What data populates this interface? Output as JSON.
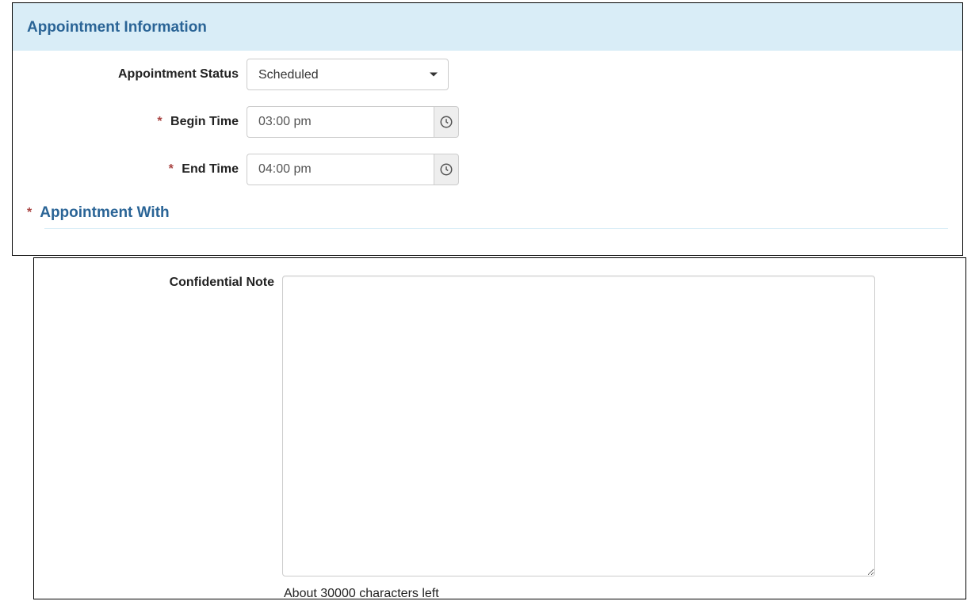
{
  "section1": {
    "title": "Appointment Information",
    "rows": {
      "status": {
        "label": "Appointment Status",
        "value": "Scheduled"
      },
      "begin": {
        "label": "Begin Time",
        "value": "03:00 pm"
      },
      "end": {
        "label": "End Time",
        "value": "04:00 pm"
      }
    },
    "sub_title": "Appointment With"
  },
  "section2": {
    "note_label": "Confidential Note",
    "note_value": "",
    "counter_text": "About 30000 characters left"
  }
}
